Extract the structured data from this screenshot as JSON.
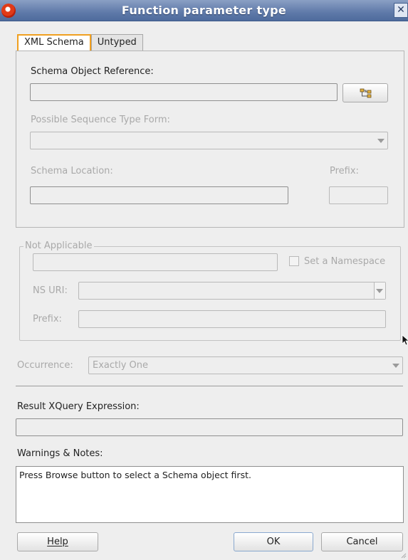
{
  "window": {
    "title": "Function parameter type"
  },
  "tabs": [
    {
      "label": "XML Schema",
      "active": true
    },
    {
      "label": "Untyped",
      "active": false
    }
  ],
  "schema": {
    "object_reference_label": "Schema Object Reference:",
    "object_reference_value": "",
    "sequence_form_label": "Possible Sequence Type Form:",
    "sequence_form_value": "",
    "location_label": "Schema Location:",
    "location_value": "",
    "prefix_label": "Prefix:",
    "prefix_value": ""
  },
  "namespace": {
    "legend": "Not Applicable",
    "name_value": "",
    "set_namespace_label": "Set a Namespace",
    "set_namespace_checked": false,
    "ns_uri_label": "NS URI:",
    "ns_uri_value": "",
    "prefix_label": "Prefix:",
    "prefix_value": ""
  },
  "occurrence": {
    "label": "Occurrence:",
    "value": "Exactly One"
  },
  "result": {
    "label": "Result XQuery Expression:",
    "value": ""
  },
  "warnings": {
    "label": "Warnings & Notes:",
    "text": "Press Browse button to select a Schema object first."
  },
  "buttons": {
    "help": "Help",
    "ok": "OK",
    "cancel": "Cancel"
  },
  "icons": {
    "app": "oracle-logo-icon",
    "close": "close-icon",
    "browse": "tree-icon",
    "dropdown": "chevron-down-icon",
    "cursor": "mouse-pointer-icon"
  },
  "colors": {
    "titlebar": "#5f7aa9",
    "active_tab_border": "#f0a020",
    "background": "#eeeeee"
  }
}
